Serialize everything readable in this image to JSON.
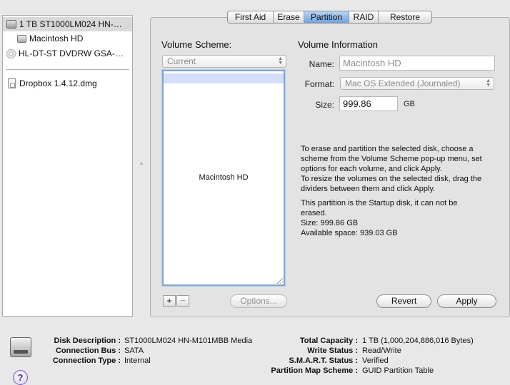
{
  "sidebar": {
    "items": [
      {
        "label": "1 TB ST1000LM024 HN-…",
        "icon": "hard-drive-icon"
      },
      {
        "label": "Macintosh HD",
        "icon": "volume-icon"
      },
      {
        "label": "HL-DT-ST DVDRW GSA-…",
        "icon": "optical-drive-icon"
      },
      {
        "label": "Dropbox 1.4.12.dmg",
        "icon": "disk-image-icon"
      }
    ]
  },
  "tabs": [
    "First Aid",
    "Erase",
    "Partition",
    "RAID",
    "Restore"
  ],
  "active_tab": "Partition",
  "partition": {
    "volume_scheme_label": "Volume Scheme:",
    "volume_scheme_value": "Current",
    "volume_info_label": "Volume Information",
    "name_label": "Name:",
    "name_value": "Macintosh HD",
    "format_label": "Format:",
    "format_value": "Mac OS Extended (Journaled)",
    "size_label": "Size:",
    "size_value": "999.86",
    "size_unit": "GB",
    "volume_map_label": "Macintosh HD",
    "instructions": [
      "To erase and partition the selected disk, choose a",
      "scheme from the Volume Scheme pop-up menu, set",
      "options for each volume, and click Apply.",
      "To resize the volumes on the selected disk, drag the",
      "dividers between them and click Apply."
    ],
    "status": [
      "This partition is the Startup disk, it can not be",
      "erased.",
      "Size: 999.86 GB",
      "Available space: 939.03 GB"
    ],
    "add_label": "+",
    "remove_label": "−",
    "options_label": "Options...",
    "revert_label": "Revert",
    "apply_label": "Apply"
  },
  "footer": {
    "left": [
      {
        "label": "Disk Description :",
        "value": "ST1000LM024 HN-M101MBB Media"
      },
      {
        "label": "Connection Bus :",
        "value": "SATA"
      },
      {
        "label": "Connection Type :",
        "value": "Internal"
      }
    ],
    "right": [
      {
        "label": "Total Capacity :",
        "value": "1 TB (1,000,204,886,016 Bytes)"
      },
      {
        "label": "Write Status :",
        "value": "Read/Write"
      },
      {
        "label": "S.M.A.R.T. Status :",
        "value": "Verified"
      },
      {
        "label": "Partition Map Scheme :",
        "value": "GUID Partition Table"
      }
    ],
    "help_label": "?"
  },
  "colors": {
    "tab_active": "#8fb7e8",
    "selection": "#d9d9d9",
    "volume_border": "#7fa4d4",
    "volume_stripe": "#d4def8"
  }
}
